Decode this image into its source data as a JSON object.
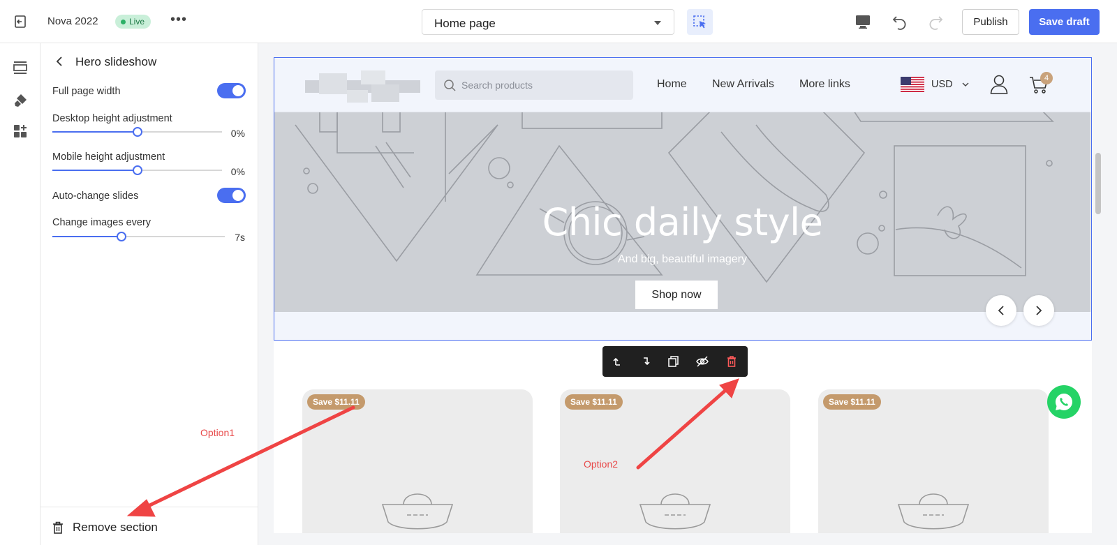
{
  "topbar": {
    "store_name": "Nova 2022",
    "live_label": "Live",
    "more_label": "•••",
    "page_selector": "Home page",
    "publish_label": "Publish",
    "save_draft_label": "Save draft"
  },
  "panel": {
    "title": "Hero slideshow",
    "full_page_width_label": "Full page width",
    "desktop_height_label": "Desktop height adjustment",
    "desktop_height_value": "0%",
    "desktop_height_level": 0.5,
    "mobile_height_label": "Mobile height adjustment",
    "mobile_height_value": "0%",
    "mobile_height_level": 0.5,
    "auto_change_label": "Auto-change slides",
    "change_every_label": "Change images every",
    "change_every_value": "7s",
    "change_every_level": 0.4,
    "remove_section_label": "Remove section"
  },
  "store": {
    "search_placeholder": "Search products",
    "nav": [
      "Home",
      "New Arrivals",
      "More links"
    ],
    "currency": "USD",
    "cart_count": "4"
  },
  "hero": {
    "title": "Chic daily style",
    "subtitle": "And big, beautiful imagery",
    "button_label": "Shop now"
  },
  "products": [
    {
      "badge": "Save $11.11"
    },
    {
      "badge": "Save $11.11"
    },
    {
      "badge": "Save $11.11"
    }
  ],
  "annotations": {
    "option1": "Option1",
    "option2": "Option2"
  },
  "colors": {
    "accent": "#4a6ef0",
    "live_bg": "#c9efd9",
    "badge": "#c49a6c",
    "annotation": "#e84a4a",
    "whatsapp": "#25d366"
  }
}
